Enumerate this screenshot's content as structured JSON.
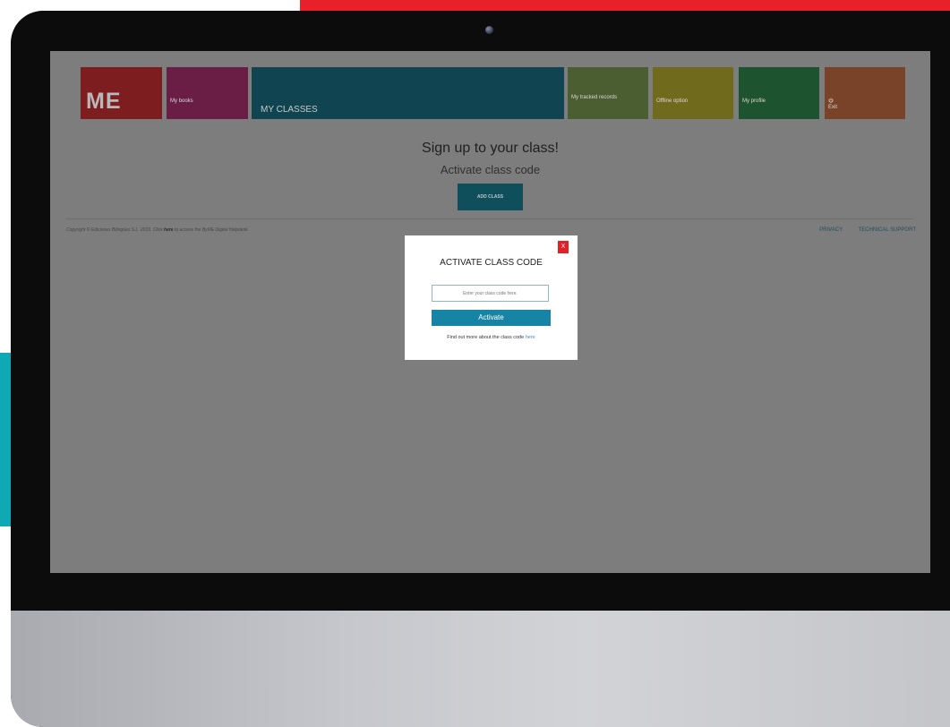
{
  "nav": {
    "logo": "ME",
    "books": "My books",
    "classes": "MY CLASSES",
    "records": "My tracked records",
    "offline": "Offline option",
    "profile": "My profile",
    "exit_icon": "power-icon",
    "exit": "Exit"
  },
  "main": {
    "heading": "Sign up to your class!",
    "subheading": "Activate class code",
    "add_class": "ADD CLASS"
  },
  "footer": {
    "copyright_prefix": "Copyright © Ediciones Bilingües S.L. 2019. Click",
    "copyright_link": "here",
    "copyright_suffix": "to access the ByME Digital Helpdesk.",
    "privacy": "PRIVACY",
    "support": "TECHNICAL SUPPORT"
  },
  "modal": {
    "close": "X",
    "title": "ACTIVATE CLASS CODE",
    "input_placeholder": "Enter your class code here.",
    "activate": "Activate",
    "help_text": "Find out more about the class code",
    "help_link": "here"
  },
  "colors": {
    "tile_logo": "#7e1d20",
    "tile_books": "#6a1e46",
    "tile_classes": "#0f4450",
    "tile_records": "#4a5e32",
    "tile_offline": "#706a1d",
    "tile_profile": "#1e532f",
    "tile_exit": "#79432a",
    "activate_button": "#1685a5",
    "close_button": "#e32026"
  }
}
